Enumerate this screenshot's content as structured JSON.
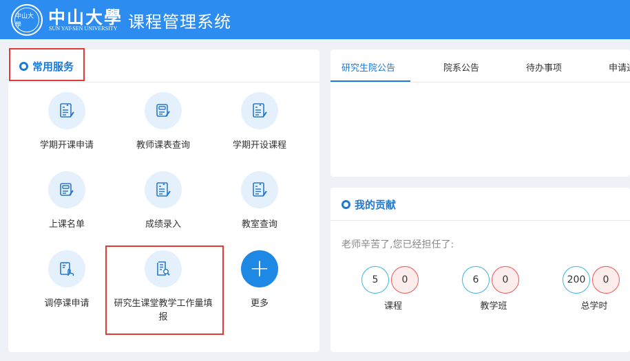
{
  "header": {
    "university_cn": "中山大學",
    "university_en": "SUN YAT-SEN UNIVERSITY",
    "system_title": "课程管理系统",
    "logo_text": "中山大學",
    "brand_color": "#2d8cf0"
  },
  "services": {
    "title": "常用服务",
    "items": [
      {
        "label": "学期开课申请",
        "icon": "document-edit-icon"
      },
      {
        "label": "教师课表查询",
        "icon": "schedule-edit-icon"
      },
      {
        "label": "学期开设课程",
        "icon": "document-edit-icon"
      },
      {
        "label": "上课名单",
        "icon": "schedule-edit-icon"
      },
      {
        "label": "成绩录入",
        "icon": "document-edit-icon"
      },
      {
        "label": "教室查询",
        "icon": "document-edit-icon"
      },
      {
        "label": "调停课申请",
        "icon": "touch-document-icon"
      },
      {
        "label": "研究生课堂教学工作量填报",
        "icon": "document-search-icon"
      },
      {
        "label": "更多",
        "icon": "plus-icon"
      }
    ]
  },
  "notices": {
    "tabs": [
      "研究生院公告",
      "院系公告",
      "待办事项",
      "申请通知"
    ],
    "active_tab": 0
  },
  "contribution": {
    "title": "我的贡献",
    "message": "老师辛苦了,您已经担任了:",
    "stats": [
      {
        "label": "课程",
        "a": "5",
        "b": "0"
      },
      {
        "label": "教学班",
        "a": "6",
        "b": "0"
      },
      {
        "label": "总学时",
        "a": "200",
        "b": "0"
      }
    ]
  }
}
